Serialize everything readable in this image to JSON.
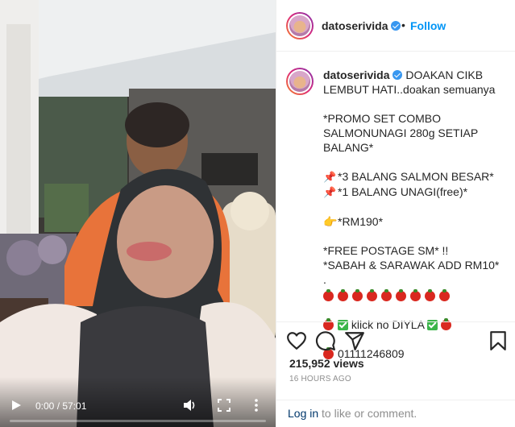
{
  "video": {
    "time": "0:00 / 57:01",
    "progress": 0.0
  },
  "header": {
    "username": "datoserivida",
    "separator": "•",
    "follow_label": "Follow"
  },
  "caption": {
    "username": "datoserivida",
    "line1": "DOAKAN CIKB LEMBUT HATI..doakan semuanya",
    "promo_line": "*PROMO SET COMBO SALMONUNAGI 280g SETIAP BALANG*",
    "item1": "*3 BALANG SALMON BESAR*",
    "item2": "*1 BALANG UNAGI(free)*",
    "price": "*RM190*",
    "postage": "*FREE POSTAGE SM* !!",
    "sabah": "*SABAH & SARAWAK ADD RM10*",
    "dot": ".",
    "klick": "klick no DIYLA",
    "phone": "01111246809"
  },
  "stats": {
    "views": "215,952 views",
    "posted": "16 HOURS AGO"
  },
  "login": {
    "link": "Log in",
    "rest": " to like or comment."
  },
  "icons": {
    "like": "heart-icon",
    "comment": "comment-icon",
    "share": "share-icon",
    "save": "bookmark-icon"
  },
  "colors": {
    "follow": "#0095f6",
    "verified": "#3897f0",
    "login_link": "#00376b"
  }
}
